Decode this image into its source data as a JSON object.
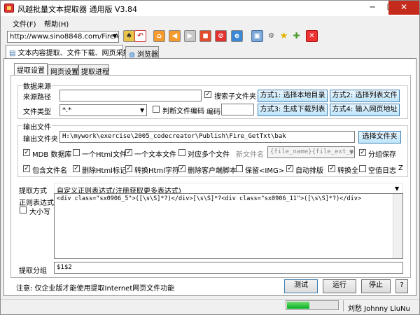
{
  "window": {
    "title": "风越批量文本提取器 通用版 V3.84",
    "controls": {
      "minimize": "─",
      "maximize": "☐",
      "close": "✕"
    }
  },
  "menu": [
    {
      "label": "文件(F)"
    },
    {
      "label": "帮助(H)"
    }
  ],
  "toolbar": {
    "url_value": "http://www.sino8848.com/FireAs",
    "icons": [
      "lock-icon",
      "undo-icon",
      "home-icon",
      "back-icon",
      "forward-icon",
      "stop-icon",
      "refresh-icon",
      "ie-icon",
      "window-icon",
      "tools-icon",
      "favorites-icon",
      "add-favorites-icon",
      "close-page-icon"
    ]
  },
  "top_tabs": [
    {
      "label": "文本内容提取、文件下载、网页采集"
    },
    {
      "label": "浏览器"
    }
  ],
  "sub_tabs": [
    {
      "label": "提取设置"
    },
    {
      "label": "网页设置"
    },
    {
      "label": "提取进程"
    }
  ],
  "source": {
    "group_label": "数据来源",
    "path_label": "来源路径",
    "path_value": "",
    "search_subfolders_label": "搜索子文件夹",
    "search_subfolders_checked": true,
    "filetype_label": "文件类型",
    "filetype_value": "*.*",
    "detect_encoding_label": "判断文件编码",
    "detect_encoding_checked": false,
    "encoding_label": "编码",
    "encoding_value": "",
    "buttons": [
      "方式1: 选择本地目录",
      "方式2: 选择列表文件",
      "方式3: 生成下载列表",
      "方式4: 输入网页地址"
    ]
  },
  "output": {
    "group_label": "输出文件",
    "folder_label": "输出文件夹",
    "folder_value": "H:\\mywork\\exercise\\2005_codecreator\\Publish\\Fire_GetTxt\\bak",
    "choose_button": "选择文件夹",
    "options_row1": [
      {
        "label": "MDB 数据库",
        "checked": true
      },
      {
        "label": "一个Html文件",
        "checked": false
      },
      {
        "label": "一个文本文件",
        "checked": true
      },
      {
        "label": "对应多个文件",
        "checked": false
      }
    ],
    "filename_label": "新文件名",
    "filename_value": "{file_name}{file_ext_name}",
    "group_save_label": "分组保存",
    "group_save_checked": true,
    "options_row2": [
      {
        "label": "包含文件名",
        "checked": true
      },
      {
        "label": "删除Html标记",
        "checked": true
      },
      {
        "label": "转换Html字符",
        "checked": true
      },
      {
        "label": "删除客户端脚本",
        "checked": true
      },
      {
        "label": "保留<IMG>",
        "checked": false
      },
      {
        "label": "自动排版",
        "checked": true
      },
      {
        "label": "转换全",
        "checked": true
      },
      {
        "label": "空值日志",
        "checked": false
      },
      {
        "label": "Z",
        "checked": false
      }
    ]
  },
  "extract": {
    "method_label": "提取方式",
    "method_value": "自定义正则表达式(注册获取更多表达式)",
    "regex_label": "正则表达式",
    "case_label": "大小写",
    "case_checked": false,
    "regex_value": "<div class=\"sx0906_5\">([\\s\\S]*?)</div>[\\s\\S]*?<div class=\"sx0906_11\">([\\s\\S]*?)</div>",
    "group_label": "提取分组",
    "group_value": "$1$2"
  },
  "footer": {
    "notice": "注意: 仅企业版才能使用提取Internet网页文件功能",
    "test_button": "测试",
    "run_button": "运行",
    "stop_button": "停止",
    "help_button": "?"
  },
  "status": {
    "progress": 0.45,
    "author": "刘愁 Johnny LiuNu"
  }
}
